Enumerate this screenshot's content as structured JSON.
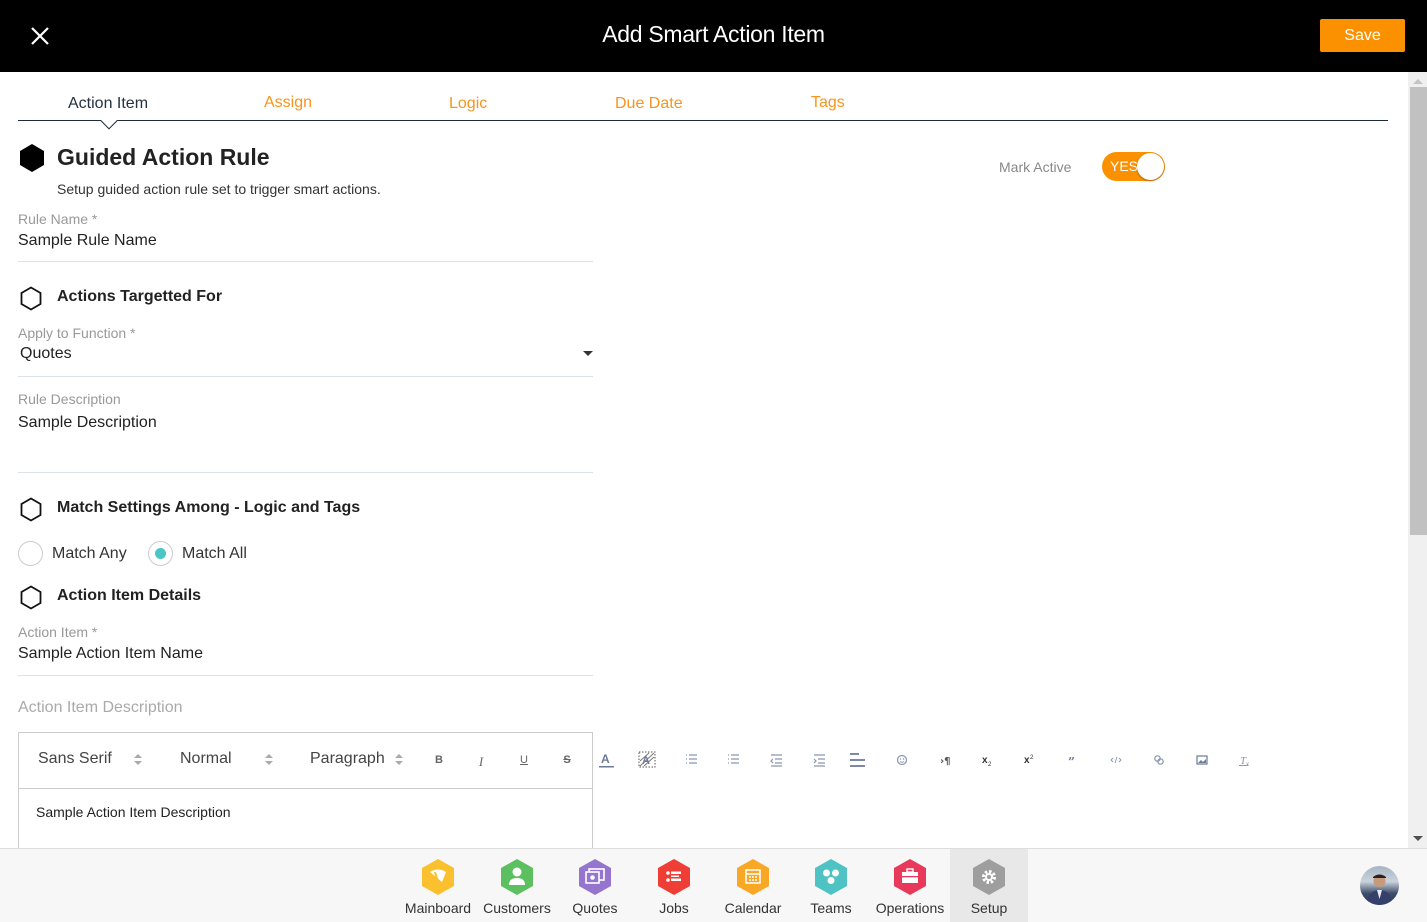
{
  "header": {
    "title": "Add Smart Action Item",
    "save_label": "Save",
    "close_icon": "close-icon"
  },
  "tabs": [
    {
      "label": "Action Item",
      "active": true
    },
    {
      "label": "Assign",
      "active": false
    },
    {
      "label": "Logic",
      "active": false
    },
    {
      "label": "Due Date",
      "active": false
    },
    {
      "label": "Tags",
      "active": false
    }
  ],
  "guided_rule": {
    "title": "Guided Action Rule",
    "subtitle": "Setup guided action rule set to trigger smart actions.",
    "mark_active_label": "Mark Active",
    "toggle_label": "YES",
    "toggle_on": true
  },
  "rule_name": {
    "label": "Rule Name *",
    "value": "Sample Rule Name"
  },
  "targeted": {
    "title": "Actions Targetted For",
    "function_label": "Apply to Function *",
    "function_value": "Quotes",
    "description_label": "Rule Description",
    "description_value": "Sample Description"
  },
  "match": {
    "title": "Match Settings Among - Logic and Tags",
    "options": [
      {
        "label": "Match Any",
        "checked": false
      },
      {
        "label": "Match All",
        "checked": true
      }
    ]
  },
  "details": {
    "title": "Action Item Details",
    "item_label": "Action Item *",
    "item_value": "Sample Action Item Name",
    "description_label": "Action Item Description",
    "editor": {
      "font": "Sans Serif",
      "size": "Normal",
      "format": "Paragraph",
      "buttons": [
        "B",
        "I",
        "U",
        "S"
      ],
      "icons": [
        "text-color-icon",
        "background-color-icon",
        "ordered-list-icon",
        "bullet-list-icon",
        "outdent-icon",
        "indent-icon",
        "align-icon",
        "emoji-icon",
        "text-direction-icon",
        "subscript-icon",
        "superscript-icon",
        "blockquote-icon",
        "code-icon",
        "link-icon",
        "image-icon",
        "clear-format-icon"
      ],
      "content": "Sample Action Item Description"
    }
  },
  "bottom_nav": {
    "items": [
      {
        "label": "Mainboard",
        "color": "#fbc02d",
        "active": false
      },
      {
        "label": "Customers",
        "color": "#5cbf60",
        "active": false
      },
      {
        "label": "Quotes",
        "color": "#9575cd",
        "active": false
      },
      {
        "label": "Jobs",
        "color": "#ef3e36",
        "active": false
      },
      {
        "label": "Calendar",
        "color": "#f9a825",
        "active": false
      },
      {
        "label": "Teams",
        "color": "#4fc3c3",
        "active": false
      },
      {
        "label": "Operations",
        "color": "#e8395b",
        "active": false
      },
      {
        "label": "Setup",
        "color": "#9e9e9e",
        "active": true
      }
    ]
  },
  "colors": {
    "accent": "#fb9100",
    "tab_inactive": "#f7941d",
    "radio_checked": "#4bc5c5"
  }
}
